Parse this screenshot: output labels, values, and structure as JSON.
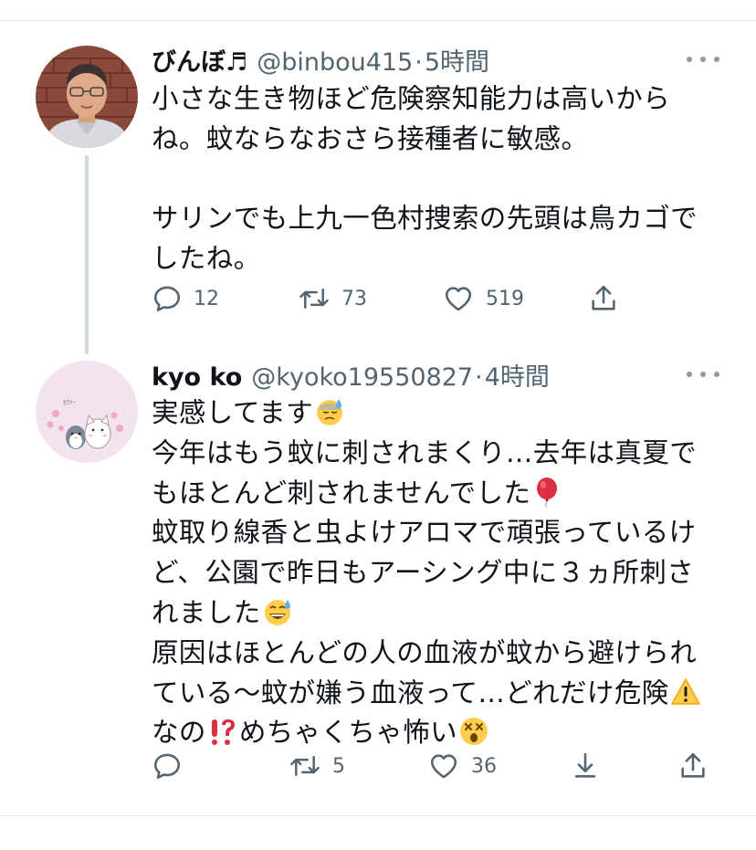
{
  "colors": {
    "text": "#0f1419",
    "secondary": "#536471",
    "divider": "#e1e8ed",
    "thread_line": "#cfd9de"
  },
  "tweets": [
    {
      "name": "びんぼ♬",
      "handle": "@binbou415",
      "dot": "·",
      "time": "5時間",
      "lines": [
        "小さな生き物ほど危険察知能力は高いから",
        "ね。蚊ならなおさら接種者に敏感。",
        "",
        "サリンでも上九一色村捜索の先頭は鳥カゴで",
        "したね。"
      ],
      "actions": {
        "reply_icon": "reply-icon",
        "reply_count": "12",
        "retweet_icon": "retweet-icon",
        "retweet_count": "73",
        "like_icon": "heart-icon",
        "like_count": "519",
        "share_icon": "share-icon"
      }
    },
    {
      "name": "kyo ko",
      "handle": "@kyoko19550827",
      "dot": "·",
      "time": "4時間",
      "lines": {
        "l1": "実感してます",
        "l2": "今年はもう蚊に刺されまくり…去年は真夏で",
        "l3": "もほとんど刺されませんでした",
        "l4": "蚊取り線香と虫よけアロマで頑張っているけ",
        "l5": "ど、公園で昨日もアーシング中に３ヵ所刺さ",
        "l6": "れました",
        "l7": "原因はほとんどの人の血液が蚊から避けられ",
        "l8": "ている〜蚊が嫌う血液って…どれだけ危険",
        "l9a": "なの",
        "l9b": "めちゃくちゃ怖い"
      },
      "emojis": {
        "e1": "downcast-sweat-emoji",
        "e2": "balloon-emoji",
        "e3": "grinning-sweat-emoji",
        "e4": "warning-emoji",
        "e5": "exclamation-question-emoji",
        "e6": "dizzy-face-emoji"
      },
      "actions": {
        "reply_icon": "reply-icon",
        "retweet_icon": "retweet-icon",
        "retweet_count": "5",
        "like_icon": "heart-icon",
        "like_count": "36",
        "download_icon": "download-icon",
        "share_icon": "share-icon"
      }
    }
  ]
}
